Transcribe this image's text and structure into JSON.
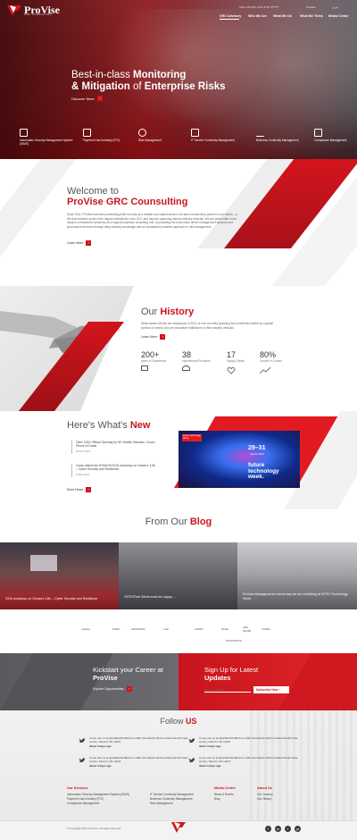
{
  "brand": {
    "name": "ProVise",
    "tagline": "GRC CONSULTING"
  },
  "topbar": {
    "phone": "CALL US 24/7 +971 4 32 ??????",
    "careers": "Careers",
    "language": "عربي"
  },
  "nav": [
    "GRC Advisory",
    "Who We Are",
    "What We Do",
    "What We Think",
    "Media Center"
  ],
  "hero": {
    "title_line1_light": "Best-in-class ",
    "title_line1_bold": "Monitoring",
    "title_line2_bold_a": "& Mitigation",
    "title_line2_light": " of ",
    "title_line2_bold_b": "Enterprise Risks",
    "cta": "Discover More",
    "services": [
      {
        "icon": "lock-document-icon",
        "label": "Information Security Management System (ISMS)"
      },
      {
        "icon": "credit-card-icon",
        "label": "Payment Card Industry (PCI)"
      },
      {
        "icon": "scales-icon",
        "label": "Risk Management"
      },
      {
        "icon": "monitor-icon",
        "label": "IT Service Continuity Management"
      },
      {
        "icon": "graph-icon",
        "label": "Business Continuity Management"
      },
      {
        "icon": "clipboard-icon",
        "label": "Compliance Management"
      }
    ]
  },
  "welcome": {
    "title_light": "Welcome to",
    "title_red": "ProVise GRC Counsulting",
    "body": "Since 2011, ProVise has been positioning itself not only as a reliable and valued advisor, but also a trustworthy partner to our clients – a link that includes some of the largest enterprises in the GCC and beyond, spanning various industry verticals. We are passionate in our mission to transform ourselves as a regional business consulting hub, by providing the most value driven management advisory and governance services through deep industry knowledge and an unmatched proactive approach to risk management.",
    "more": "Learn More"
  },
  "history": {
    "title_light": "Our ",
    "title_red": "History",
    "body": "What started off with two employees in 2011, is now an entity spanning two continents trusted by a global portfolio of clients who are innovative trailblazers in their industry verticals.",
    "more": "Learn More",
    "stats": [
      {
        "num": "200+",
        "label": "years of Experience",
        "icon": "briefcase-icon"
      },
      {
        "num": "38",
        "label": "experienced Provisers",
        "icon": "people-icon"
      },
      {
        "num": "17",
        "label": "Happy Clients",
        "icon": "heart-icon"
      },
      {
        "num": "80%",
        "label": "Growth in 4 years",
        "icon": "growth-icon"
      }
    ]
  },
  "news": {
    "title_light": "Here's What's ",
    "title_red": "New",
    "items": [
      {
        "text": "Gitex 2016 Official Opening by HH Sheikh Hamdan, Crown Prince of Dubai",
        "date": "29 Oct 2016"
      },
      {
        "text": "Come attend the ROSeOfi 2016 workshop on Ocean's 11th – Cyber Security and Resilience",
        "date": "9 Mar 2016"
      }
    ],
    "more": "More News",
    "poster": {
      "badge": "Future Technology Week",
      "dates": "29–31",
      "month": "march 2016",
      "title1": "future",
      "title2": "technology",
      "title3": "week."
    }
  },
  "blog": {
    "title_light": "From Our ",
    "title_red": "Blog",
    "posts": [
      {
        "title": "2016 workshop on Ocean's 11th – Cyber Security and Resilience"
      },
      {
        "title": "GITEXTech Week ends fun happy ..."
      },
      {
        "title": "ProVise Management's recent day we are exhibiting at GITEX Technology Week"
      }
    ]
  },
  "partners": [
    "etisalat",
    "SAMA",
    "EMIRATES",
    "seal",
    "FAWRI",
    "Dubai",
    "PASSPORTS",
    "ABU DHABI",
    "DUBAI"
  ],
  "cta": {
    "career_light": "Kickstart your Career at",
    "career_bold": "ProVise",
    "career_btn": "Explore Opportunities",
    "signup_light": "Sign Up for Latest",
    "signup_bold": "Updates",
    "email_placeholder": "Enter your Email",
    "subscribe_btn": "Subscribe Now"
  },
  "follow": {
    "title_light": "Follow ",
    "title_red": "US",
    "tweets": [
      {
        "text": "Come visit us at @GISEC/DUBAI from 29th-31st March 2016 at Dubai World Trade Centre, Stand C-18, Hall 8",
        "time": "about 3 days ago"
      },
      {
        "text": "Come visit us at @GISEC/DUBAI from 29th-31st March 2016 at Dubai World Trade Centre, Stand C-18, Hall 8",
        "time": "about 3 days ago"
      },
      {
        "text": "Come visit us at @GISEC/DUBAI from 29th-31st March 2016 at Dubai World Trade Centre, Stand C-18, Hall 8",
        "time": "about 3 days ago"
      },
      {
        "text": "Come visit us at @GISEC/DUBAI from 29th-31st March 2016 at Dubai World Trade Centre, Stand C-18, Hall 8",
        "time": "about 3 days ago"
      }
    ]
  },
  "footer": {
    "services_title": "Our Services",
    "services_col1": [
      "Information Security Management System (ISMS)",
      "Payment Card Industry (PCI)",
      "Compliance Management"
    ],
    "services_col2": [
      "IT Service Continuity Management",
      "Business Continuity Management",
      "Risk Management"
    ],
    "media_title": "Media Centre",
    "media_items": [
      "News & Events",
      "Blog"
    ],
    "about_title": "About Us",
    "about_items": [
      "Our Journey",
      "Our History"
    ],
    "copyright": "© Copyright 2017 ProVise. All rights reserved.",
    "social": [
      "f",
      "in",
      "t",
      "yt"
    ]
  },
  "colors": {
    "accent": "#c8161d",
    "dark": "#333333"
  }
}
